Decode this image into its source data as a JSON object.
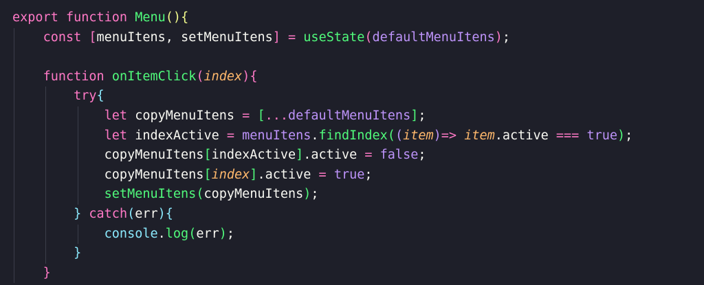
{
  "colors": {
    "background": "#1e1f29",
    "keyword": "#ff79c6",
    "function": "#50fa7b",
    "text": "#f8f8f2",
    "parameter": "#ffb86c",
    "boolean": "#bd93f9",
    "bracket_cyan": "#8be9fd",
    "bracket_yellow": "#f1fa8c",
    "indent_guide": "#3b3d4a"
  },
  "lines": [
    {
      "indent": 0,
      "tokens": [
        {
          "t": "export",
          "c": "kw"
        },
        {
          "t": " ",
          "c": "plain"
        },
        {
          "t": "function",
          "c": "kw"
        },
        {
          "t": " ",
          "c": "plain"
        },
        {
          "t": "Menu",
          "c": "fn"
        },
        {
          "t": "()",
          "c": "b-yellow"
        },
        {
          "t": "{",
          "c": "b-yellow"
        }
      ]
    },
    {
      "indent": 1,
      "tokens": [
        {
          "t": "const",
          "c": "kw"
        },
        {
          "t": " ",
          "c": "plain"
        },
        {
          "t": "[",
          "c": "b-pink"
        },
        {
          "t": "menuItens",
          "c": "plain"
        },
        {
          "t": ", ",
          "c": "plain"
        },
        {
          "t": "setMenuItens",
          "c": "plain"
        },
        {
          "t": "]",
          "c": "b-pink"
        },
        {
          "t": " ",
          "c": "plain"
        },
        {
          "t": "=",
          "c": "op"
        },
        {
          "t": " ",
          "c": "plain"
        },
        {
          "t": "useState",
          "c": "fn"
        },
        {
          "t": "(",
          "c": "b-pink"
        },
        {
          "t": "defaultMenuItens",
          "c": "bool"
        },
        {
          "t": ")",
          "c": "b-pink"
        },
        {
          "t": ";",
          "c": "plain"
        }
      ]
    },
    {
      "indent": 1,
      "tokens": []
    },
    {
      "indent": 1,
      "tokens": [
        {
          "t": "function",
          "c": "kw"
        },
        {
          "t": " ",
          "c": "plain"
        },
        {
          "t": "onItemClick",
          "c": "fn"
        },
        {
          "t": "(",
          "c": "b-pink"
        },
        {
          "t": "index",
          "c": "param"
        },
        {
          "t": ")",
          "c": "b-pink"
        },
        {
          "t": "{",
          "c": "b-pink"
        }
      ]
    },
    {
      "indent": 2,
      "tokens": [
        {
          "t": "try",
          "c": "kw"
        },
        {
          "t": "{",
          "c": "b-cyan"
        }
      ]
    },
    {
      "indent": 3,
      "tokens": [
        {
          "t": "let",
          "c": "kw"
        },
        {
          "t": " copyMenuItens ",
          "c": "plain"
        },
        {
          "t": "=",
          "c": "op"
        },
        {
          "t": " ",
          "c": "plain"
        },
        {
          "t": "[",
          "c": "b-green"
        },
        {
          "t": "...",
          "c": "kw"
        },
        {
          "t": "defaultMenuItens",
          "c": "bool"
        },
        {
          "t": "]",
          "c": "b-green"
        },
        {
          "t": ";",
          "c": "plain"
        }
      ]
    },
    {
      "indent": 3,
      "tokens": [
        {
          "t": "let",
          "c": "kw"
        },
        {
          "t": " indexActive ",
          "c": "plain"
        },
        {
          "t": "=",
          "c": "op"
        },
        {
          "t": " ",
          "c": "plain"
        },
        {
          "t": "menuItens",
          "c": "bool"
        },
        {
          "t": ".",
          "c": "plain"
        },
        {
          "t": "findIndex",
          "c": "fn"
        },
        {
          "t": "(",
          "c": "b-green"
        },
        {
          "t": "(",
          "c": "b-purple"
        },
        {
          "t": "item",
          "c": "param"
        },
        {
          "t": ")",
          "c": "b-purple"
        },
        {
          "t": "=>",
          "c": "op"
        },
        {
          "t": " ",
          "c": "plain"
        },
        {
          "t": "item",
          "c": "param"
        },
        {
          "t": ".active ",
          "c": "plain"
        },
        {
          "t": "===",
          "c": "op"
        },
        {
          "t": " ",
          "c": "plain"
        },
        {
          "t": "true",
          "c": "bool"
        },
        {
          "t": ")",
          "c": "b-green"
        },
        {
          "t": ";",
          "c": "plain"
        }
      ]
    },
    {
      "indent": 3,
      "tokens": [
        {
          "t": "copyMenuItens",
          "c": "plain"
        },
        {
          "t": "[",
          "c": "b-green"
        },
        {
          "t": "indexActive",
          "c": "plain"
        },
        {
          "t": "]",
          "c": "b-green"
        },
        {
          "t": ".active ",
          "c": "plain"
        },
        {
          "t": "=",
          "c": "op"
        },
        {
          "t": " ",
          "c": "plain"
        },
        {
          "t": "false",
          "c": "bool"
        },
        {
          "t": ";",
          "c": "plain"
        }
      ]
    },
    {
      "indent": 3,
      "tokens": [
        {
          "t": "copyMenuItens",
          "c": "plain"
        },
        {
          "t": "[",
          "c": "b-green"
        },
        {
          "t": "index",
          "c": "param"
        },
        {
          "t": "]",
          "c": "b-green"
        },
        {
          "t": ".active ",
          "c": "plain"
        },
        {
          "t": "=",
          "c": "op"
        },
        {
          "t": " ",
          "c": "plain"
        },
        {
          "t": "true",
          "c": "bool"
        },
        {
          "t": ";",
          "c": "plain"
        }
      ]
    },
    {
      "indent": 3,
      "tokens": [
        {
          "t": "setMenuItens",
          "c": "fn"
        },
        {
          "t": "(",
          "c": "b-green"
        },
        {
          "t": "copyMenuItens",
          "c": "plain"
        },
        {
          "t": ")",
          "c": "b-green"
        },
        {
          "t": ";",
          "c": "plain"
        }
      ]
    },
    {
      "indent": 2,
      "tokens": [
        {
          "t": "}",
          "c": "b-cyan"
        },
        {
          "t": " ",
          "c": "plain"
        },
        {
          "t": "catch",
          "c": "kw"
        },
        {
          "t": "(",
          "c": "b-cyan"
        },
        {
          "t": "err",
          "c": "plain"
        },
        {
          "t": ")",
          "c": "b-cyan"
        },
        {
          "t": "{",
          "c": "b-cyan"
        }
      ]
    },
    {
      "indent": 3,
      "tokens": [
        {
          "t": "console",
          "c": "b-cyan"
        },
        {
          "t": ".",
          "c": "plain"
        },
        {
          "t": "log",
          "c": "fn"
        },
        {
          "t": "(",
          "c": "b-green"
        },
        {
          "t": "err",
          "c": "plain"
        },
        {
          "t": ")",
          "c": "b-green"
        },
        {
          "t": ";",
          "c": "plain"
        }
      ]
    },
    {
      "indent": 2,
      "tokens": [
        {
          "t": "}",
          "c": "b-cyan"
        }
      ]
    },
    {
      "indent": 1,
      "tokens": [
        {
          "t": "}",
          "c": "b-pink"
        }
      ]
    }
  ]
}
